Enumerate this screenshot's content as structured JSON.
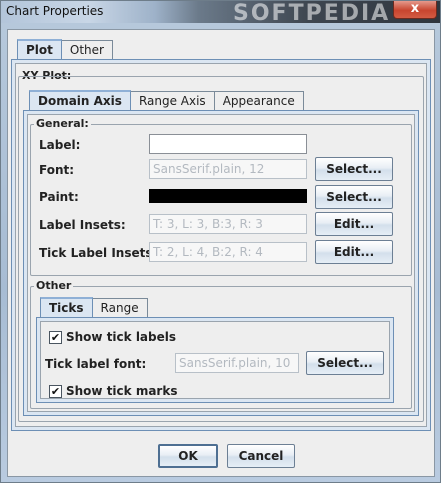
{
  "window": {
    "title": "Chart Properties",
    "watermark": "SOFTPEDIA",
    "close_glyph": "x"
  },
  "top_tabs": [
    {
      "label": "Plot",
      "active": true
    },
    {
      "label": "Other",
      "active": false
    }
  ],
  "xy_plot_legend": "XY Plot:",
  "axis_tabs": [
    {
      "label": "Domain Axis",
      "active": true
    },
    {
      "label": "Range Axis",
      "active": false
    },
    {
      "label": "Appearance",
      "active": false
    }
  ],
  "general": {
    "legend": "General:",
    "label_label": "Label:",
    "label_value": "",
    "font_label": "Font:",
    "font_value": "SansSerif.plain, 12",
    "font_button": "Select...",
    "paint_label": "Paint:",
    "paint_color": "#000000",
    "paint_button": "Select...",
    "label_insets_label": "Label Insets:",
    "label_insets_value": "T: 3, L: 3, B:3, R: 3",
    "label_insets_button": "Edit...",
    "tick_label_insets_label": "Tick Label Insets:",
    "tick_label_insets_value": "T: 2, L: 4, B:2, R: 4",
    "tick_label_insets_button": "Edit..."
  },
  "other": {
    "legend": "Other",
    "tabs": [
      {
        "label": "Ticks",
        "active": true
      },
      {
        "label": "Range",
        "active": false
      }
    ],
    "show_tick_labels": {
      "label": "Show tick labels",
      "checked": true
    },
    "tick_label_font_label": "Tick label font:",
    "tick_label_font_value": "SansSerif.plain, 10",
    "tick_label_font_button": "Select...",
    "show_tick_marks": {
      "label": "Show tick marks",
      "checked": true
    }
  },
  "footer": {
    "ok": "OK",
    "cancel": "Cancel"
  },
  "check_glyph": "✔"
}
